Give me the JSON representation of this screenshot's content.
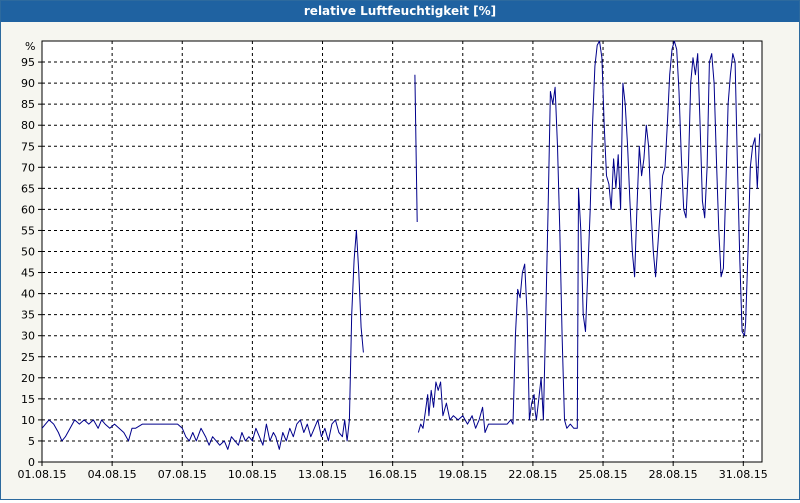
{
  "window": {
    "title": "relative Luftfeuchtigkeit [%]"
  },
  "colors": {
    "title_bar": "#1f62a1",
    "plot_background": "#ffffff",
    "series_line": "#00008b",
    "grid": "#000000"
  },
  "chart_data": {
    "type": "line",
    "title": "relative Luftfeuchtigkeit [%]",
    "xlabel": "",
    "ylabel": "%",
    "ylim": [
      0,
      100
    ],
    "xlim": [
      "01.08.15",
      "01.09.15 08:00"
    ],
    "x_unit": "day",
    "grid": true,
    "legend": "none",
    "x_ticks": [
      "01.08.15",
      "04.08.15",
      "07.08.15",
      "10.08.15",
      "13.08.15",
      "16.08.15",
      "19.08.15",
      "22.08.15",
      "25.08.15",
      "28.08.15",
      "31.08.15"
    ],
    "y_ticks": [
      "0",
      "5",
      "10",
      "15",
      "20",
      "25",
      "30",
      "35",
      "40",
      "45",
      "50",
      "55",
      "60",
      "65",
      "70",
      "75",
      "80",
      "85",
      "90",
      "95"
    ],
    "series": [
      {
        "segments": [
          [
            [
              0,
              8
            ],
            [
              0.15,
              9
            ],
            [
              0.3,
              10
            ],
            [
              0.5,
              9
            ],
            [
              0.7,
              7
            ],
            [
              0.85,
              5
            ],
            [
              1.0,
              6
            ],
            [
              1.2,
              8
            ],
            [
              1.4,
              10
            ],
            [
              1.6,
              9
            ],
            [
              1.8,
              10
            ],
            [
              2.0,
              9
            ],
            [
              2.2,
              10
            ],
            [
              2.4,
              8
            ],
            [
              2.55,
              10
            ],
            [
              2.7,
              9
            ],
            [
              2.9,
              8
            ],
            [
              3.1,
              9
            ],
            [
              3.3,
              8
            ],
            [
              3.5,
              7
            ],
            [
              3.7,
              5
            ],
            [
              3.85,
              8
            ],
            [
              4.0,
              8
            ],
            [
              4.3,
              9
            ],
            [
              4.6,
              9
            ],
            [
              5.0,
              9
            ],
            [
              5.4,
              9
            ],
            [
              5.8,
              9
            ],
            [
              6.0,
              8
            ],
            [
              6.15,
              6
            ],
            [
              6.3,
              5
            ],
            [
              6.45,
              7
            ],
            [
              6.6,
              5
            ],
            [
              6.8,
              8
            ],
            [
              7.0,
              6
            ],
            [
              7.15,
              4
            ],
            [
              7.3,
              6
            ],
            [
              7.45,
              5
            ],
            [
              7.6,
              4
            ],
            [
              7.8,
              5
            ],
            [
              7.95,
              3
            ],
            [
              8.1,
              6
            ],
            [
              8.25,
              5
            ],
            [
              8.4,
              4
            ],
            [
              8.55,
              7
            ],
            [
              8.7,
              5
            ],
            [
              8.85,
              6
            ],
            [
              9.0,
              5
            ],
            [
              9.15,
              8
            ],
            [
              9.3,
              6
            ],
            [
              9.45,
              4
            ],
            [
              9.6,
              9
            ],
            [
              9.75,
              5
            ],
            [
              9.9,
              7
            ],
            [
              10.0,
              6
            ],
            [
              10.15,
              3
            ],
            [
              10.3,
              7
            ],
            [
              10.45,
              5
            ],
            [
              10.6,
              8
            ],
            [
              10.75,
              6
            ],
            [
              10.9,
              9
            ],
            [
              11.05,
              10
            ],
            [
              11.2,
              7
            ],
            [
              11.35,
              9
            ],
            [
              11.5,
              6
            ],
            [
              11.65,
              8
            ],
            [
              11.8,
              10
            ],
            [
              11.95,
              6
            ],
            [
              12.1,
              8
            ],
            [
              12.25,
              5
            ],
            [
              12.4,
              9
            ],
            [
              12.55,
              10
            ],
            [
              12.7,
              7
            ],
            [
              12.85,
              6
            ],
            [
              12.95,
              10
            ],
            [
              13.05,
              5
            ],
            [
              13.15,
              10
            ],
            [
              13.25,
              35
            ],
            [
              13.35,
              48
            ],
            [
              13.45,
              55
            ],
            [
              13.55,
              45
            ],
            [
              13.65,
              32
            ],
            [
              13.75,
              26
            ]
          ],
          [
            [
              15.95,
              92
            ],
            [
              16.0,
              75
            ],
            [
              16.05,
              57
            ]
          ],
          [
            [
              16.1,
              7
            ],
            [
              16.2,
              9
            ],
            [
              16.3,
              8
            ],
            [
              16.4,
              12
            ],
            [
              16.5,
              16
            ],
            [
              16.55,
              11
            ],
            [
              16.65,
              17
            ],
            [
              16.75,
              13
            ],
            [
              16.85,
              19
            ],
            [
              16.95,
              17
            ],
            [
              17.05,
              19
            ],
            [
              17.15,
              11
            ],
            [
              17.3,
              14
            ],
            [
              17.45,
              10
            ],
            [
              17.6,
              11
            ],
            [
              17.8,
              10
            ],
            [
              18.0,
              11
            ],
            [
              18.2,
              9
            ],
            [
              18.4,
              11
            ],
            [
              18.55,
              8
            ],
            [
              18.7,
              10
            ],
            [
              18.85,
              13
            ],
            [
              18.95,
              7
            ],
            [
              19.1,
              9
            ],
            [
              19.4,
              9
            ],
            [
              19.7,
              9
            ],
            [
              19.9,
              9
            ],
            [
              20.05,
              10
            ],
            [
              20.15,
              9
            ],
            [
              20.25,
              30
            ],
            [
              20.35,
              41
            ],
            [
              20.45,
              39
            ],
            [
              20.55,
              45
            ],
            [
              20.65,
              47
            ],
            [
              20.75,
              35
            ],
            [
              20.85,
              10
            ],
            [
              20.95,
              14
            ],
            [
              21.05,
              16
            ],
            [
              21.1,
              12
            ],
            [
              21.15,
              10
            ],
            [
              21.25,
              15
            ],
            [
              21.35,
              20
            ],
            [
              21.45,
              10
            ],
            [
              21.55,
              35
            ],
            [
              21.65,
              60
            ],
            [
              21.75,
              88
            ],
            [
              21.85,
              85
            ],
            [
              21.95,
              89
            ],
            [
              22.05,
              75
            ],
            [
              22.15,
              55
            ],
            [
              22.25,
              30
            ],
            [
              22.35,
              10
            ],
            [
              22.45,
              8
            ],
            [
              22.6,
              9
            ],
            [
              22.75,
              8
            ],
            [
              22.9,
              8
            ],
            [
              22.95,
              65
            ],
            [
              23.05,
              55
            ],
            [
              23.15,
              35
            ],
            [
              23.25,
              31
            ],
            [
              23.35,
              45
            ],
            [
              23.45,
              60
            ],
            [
              23.55,
              80
            ],
            [
              23.65,
              94
            ],
            [
              23.75,
              99
            ],
            [
              23.85,
              100
            ],
            [
              23.95,
              96
            ],
            [
              24.05,
              80
            ],
            [
              24.15,
              68
            ],
            [
              24.25,
              66
            ],
            [
              24.35,
              60
            ],
            [
              24.45,
              72
            ],
            [
              24.55,
              65
            ],
            [
              24.65,
              73
            ],
            [
              24.75,
              60
            ],
            [
              24.85,
              90
            ],
            [
              24.95,
              85
            ],
            [
              25.05,
              75
            ],
            [
              25.15,
              62
            ],
            [
              25.25,
              50
            ],
            [
              25.35,
              44
            ],
            [
              25.45,
              60
            ],
            [
              25.55,
              75
            ],
            [
              25.65,
              68
            ],
            [
              25.75,
              72
            ],
            [
              25.85,
              80
            ],
            [
              25.95,
              75
            ],
            [
              26.05,
              60
            ],
            [
              26.15,
              50
            ],
            [
              26.25,
              44
            ],
            [
              26.35,
              52
            ],
            [
              26.45,
              60
            ],
            [
              26.55,
              68
            ],
            [
              26.65,
              70
            ],
            [
              26.75,
              80
            ],
            [
              26.85,
              92
            ],
            [
              26.95,
              98
            ],
            [
              27.05,
              100
            ],
            [
              27.15,
              98
            ],
            [
              27.25,
              88
            ],
            [
              27.35,
              72
            ],
            [
              27.45,
              60
            ],
            [
              27.55,
              58
            ],
            [
              27.65,
              70
            ],
            [
              27.75,
              90
            ],
            [
              27.85,
              96
            ],
            [
              27.95,
              92
            ],
            [
              28.05,
              97
            ],
            [
              28.15,
              80
            ],
            [
              28.25,
              62
            ],
            [
              28.35,
              58
            ],
            [
              28.45,
              70
            ],
            [
              28.55,
              95
            ],
            [
              28.65,
              97
            ],
            [
              28.75,
              90
            ],
            [
              28.85,
              72
            ],
            [
              28.95,
              55
            ],
            [
              29.05,
              44
            ],
            [
              29.15,
              46
            ],
            [
              29.25,
              65
            ],
            [
              29.35,
              85
            ],
            [
              29.45,
              92
            ],
            [
              29.55,
              97
            ],
            [
              29.65,
              95
            ],
            [
              29.75,
              70
            ],
            [
              29.85,
              48
            ],
            [
              29.95,
              31
            ],
            [
              30.05,
              30
            ],
            [
              30.1,
              33
            ],
            [
              30.2,
              50
            ],
            [
              30.3,
              70
            ],
            [
              30.4,
              75
            ],
            [
              30.5,
              77
            ],
            [
              30.6,
              65
            ],
            [
              30.7,
              78
            ]
          ]
        ]
      }
    ]
  }
}
